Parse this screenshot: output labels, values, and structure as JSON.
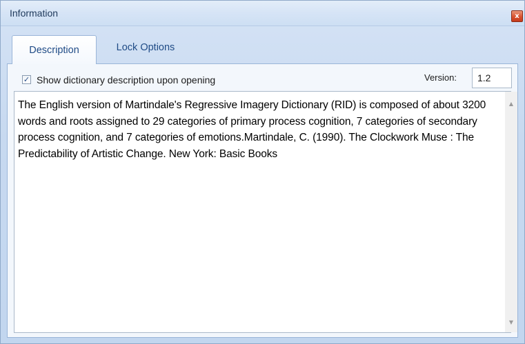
{
  "window": {
    "title": "Information",
    "close_glyph": "x"
  },
  "tabs": [
    {
      "label": "Description",
      "active": true
    },
    {
      "label": "Lock Options",
      "active": false
    }
  ],
  "options": {
    "show_description_label": "Show dictionary description upon opening",
    "show_description_checked": true,
    "check_glyph": "✓",
    "version_label": "Version:",
    "version_value": "1.2"
  },
  "description": {
    "text": "The English version of Martindale's Regressive Imagery Dictionary (RID) is composed of about 3200 words and roots assigned to 29 categories of primary process cognition, 7 categories of secondary process cognition, and 7 categories of emotions.Martindale, C. (1990). The Clockwork Muse : The Predictability of Artistic Change. New York: Basic Books"
  },
  "scrollbar": {
    "up_glyph": "▲",
    "down_glyph": "▼"
  },
  "colors": {
    "window_frame": "#c7d9f0",
    "tab_text": "#1f4b86",
    "close_button": "#d9532f"
  }
}
